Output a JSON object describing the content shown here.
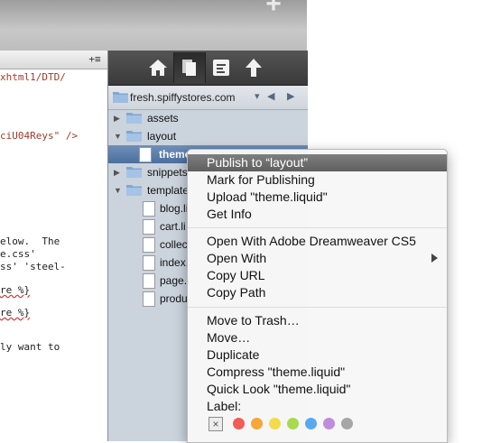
{
  "editor": {
    "tab_menu": "+≡",
    "lines": [
      {
        "text": "xhtml1/DTD/"
      },
      {
        "text": "ciU04Reys\" />"
      },
      {
        "text": "elow.  The"
      },
      {
        "text": "e.css'"
      },
      {
        "text": "ss' 'steel-"
      },
      {
        "text": "re %}"
      },
      {
        "text": "re %}"
      },
      {
        "text": "ly want to"
      }
    ]
  },
  "browser": {
    "toolbar_icons": [
      "home-icon",
      "documents-icon",
      "info-icon",
      "upload-icon"
    ],
    "path": "fresh.spiffystores.com",
    "tree": [
      {
        "label": "assets",
        "type": "folder",
        "expanded": false
      },
      {
        "label": "layout",
        "type": "folder",
        "expanded": true
      },
      {
        "label": "theme",
        "type": "file",
        "selected": true
      },
      {
        "label": "snippets",
        "type": "folder",
        "expanded": false
      },
      {
        "label": "template",
        "type": "folder",
        "expanded": true
      },
      {
        "label": "blog.li",
        "type": "file"
      },
      {
        "label": "cart.li",
        "type": "file"
      },
      {
        "label": "collect",
        "type": "file"
      },
      {
        "label": "index.",
        "type": "file"
      },
      {
        "label": "page.l",
        "type": "file"
      },
      {
        "label": "produ",
        "type": "file"
      }
    ]
  },
  "context_menu": {
    "groups": [
      [
        "Publish to “layout”",
        "Mark for Publishing",
        "Upload \"theme.liquid\"",
        "Get Info"
      ],
      [
        "Open With Adobe Dreamweaver CS5",
        "Open With",
        "Copy URL",
        "Copy Path"
      ],
      [
        "Move to Trash…",
        "Move…",
        "Duplicate",
        "Compress \"theme.liquid\"",
        "Quick Look \"theme.liquid\""
      ]
    ],
    "highlighted": "Publish to “layout”",
    "submenu_item": "Open With",
    "label_title": "Label:",
    "label_none": "×",
    "label_colors": [
      "#f25b56",
      "#f6a73a",
      "#f1dc4b",
      "#a9d94e",
      "#58aaf0",
      "#c08cdf",
      "#a6a6a6"
    ]
  }
}
